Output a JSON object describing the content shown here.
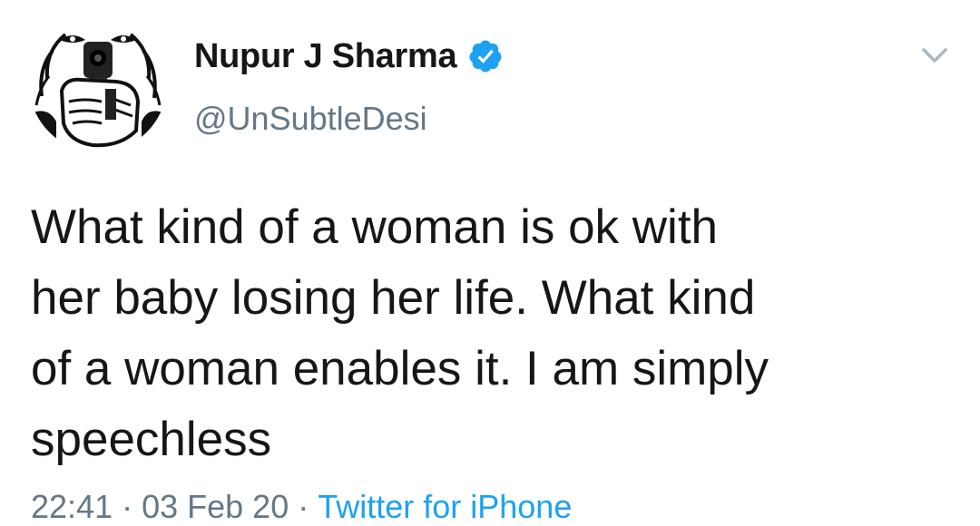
{
  "user": {
    "display_name": "Nupur J Sharma",
    "handle": "@UnSubtleDesi",
    "verified": true,
    "avatar_icon": "avatar-man-holding-gun"
  },
  "tweet": {
    "text_lines": [
      "What kind of a woman is ok with",
      "her baby losing her life. What kind",
      "of a woman enables it. I am simply",
      "speechless"
    ]
  },
  "meta": {
    "time": "22:41",
    "date": "03 Feb 20",
    "separator": "·",
    "source": "Twitter for iPhone"
  },
  "icons": {
    "verified": "verified-badge-icon",
    "menu": "chevron-down-icon"
  },
  "colors": {
    "text": "#14171a",
    "secondary": "#657786",
    "link": "#1da1f2",
    "verified": "#1da1f2"
  }
}
